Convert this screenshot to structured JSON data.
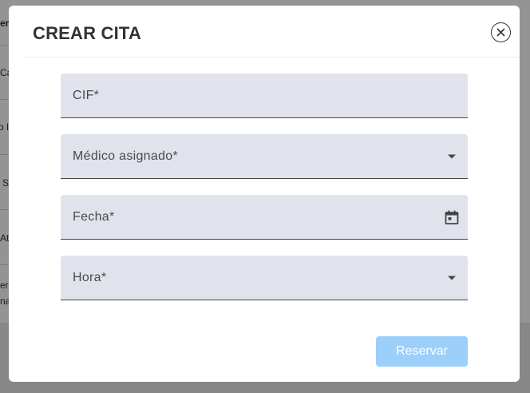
{
  "background": {
    "header_fragment": "er",
    "rows": [
      "Ca",
      "o E",
      "S",
      "At",
      "ern"
    ],
    "row_extra": "na"
  },
  "modal": {
    "title": "CREAR CITA",
    "close_icon": "close-circle-icon",
    "fields": [
      {
        "label": "CIF*",
        "type": "text"
      },
      {
        "label": "Médico asignado*",
        "type": "select",
        "icon": "dropdown-arrow-icon"
      },
      {
        "label": "Fecha*",
        "type": "date",
        "icon": "calendar-icon"
      },
      {
        "label": "Hora*",
        "type": "select",
        "icon": "dropdown-arrow-icon"
      }
    ],
    "submit_label": "Reservar"
  },
  "colors": {
    "field_background": "#e1e3ec",
    "submit_disabled": "#9ccffa",
    "title_text": "#333333"
  }
}
